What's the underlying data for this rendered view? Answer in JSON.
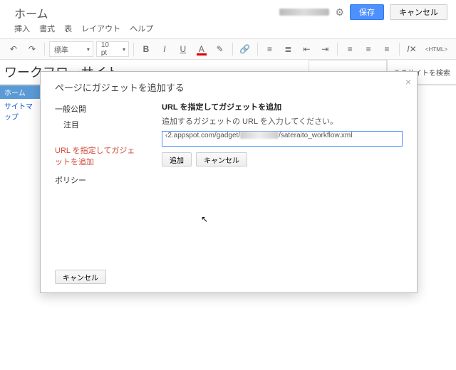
{
  "doc_title": "ホーム",
  "top_buttons": {
    "save": "保存",
    "cancel": "キャンセル"
  },
  "menu": [
    "挿入",
    "書式",
    "表",
    "レイアウト",
    "ヘルプ"
  ],
  "toolbar": {
    "style_select": "標準",
    "font_size": "10 pt",
    "html_label": "<HTML>"
  },
  "breadcrumb": "ワークフローサイト",
  "search_site": "このサイトを検索",
  "sidebar": [
    {
      "label": "ホーム",
      "active": true
    },
    {
      "label": "サイトマップ",
      "active": false
    }
  ],
  "modal": {
    "title": "ページにガジェットを追加する",
    "nav": [
      {
        "label": "一般公開",
        "key": "public"
      },
      {
        "label": "注目",
        "key": "featured",
        "sub": true
      },
      {
        "label": "URL を指定してガジェットを追加",
        "key": "byurl",
        "active": true
      },
      {
        "label": "ポリシー",
        "key": "policy"
      }
    ],
    "heading": "URL を指定してガジェットを追加",
    "desc": "追加するガジェットの URL を入力してください。",
    "url_prefix": "‹2.appspot.com/gadget/",
    "url_suffix": "/sateraito_workflow.xml",
    "add": "追加",
    "cancel": "キャンセル",
    "footer_cancel": "キャンセル"
  }
}
